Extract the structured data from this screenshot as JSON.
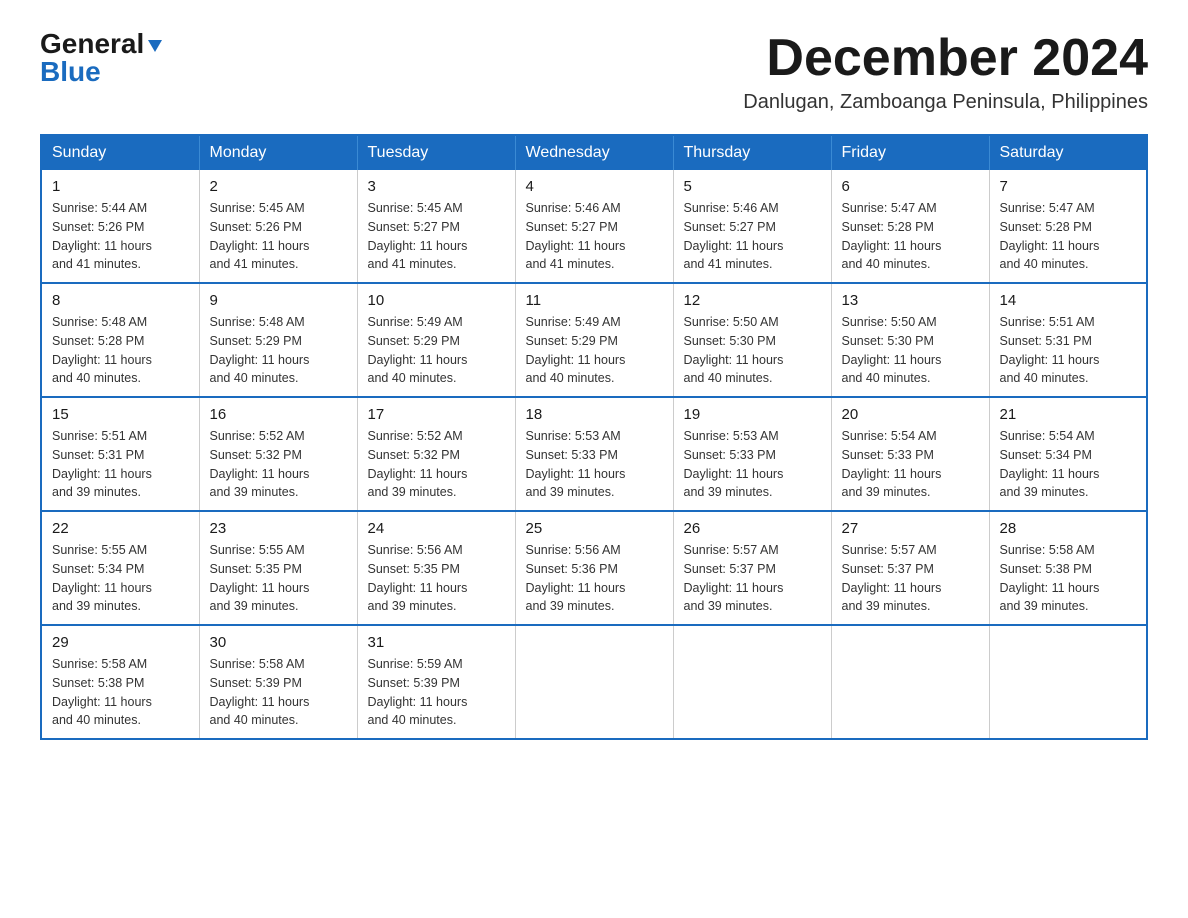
{
  "logo": {
    "general": "General",
    "blue": "Blue",
    "triangle": "▶"
  },
  "title": {
    "month_year": "December 2024",
    "location": "Danlugan, Zamboanga Peninsula, Philippines"
  },
  "header": {
    "days": [
      "Sunday",
      "Monday",
      "Tuesday",
      "Wednesday",
      "Thursday",
      "Friday",
      "Saturday"
    ]
  },
  "weeks": [
    [
      {
        "day": "1",
        "info": "Sunrise: 5:44 AM\nSunset: 5:26 PM\nDaylight: 11 hours\nand 41 minutes."
      },
      {
        "day": "2",
        "info": "Sunrise: 5:45 AM\nSunset: 5:26 PM\nDaylight: 11 hours\nand 41 minutes."
      },
      {
        "day": "3",
        "info": "Sunrise: 5:45 AM\nSunset: 5:27 PM\nDaylight: 11 hours\nand 41 minutes."
      },
      {
        "day": "4",
        "info": "Sunrise: 5:46 AM\nSunset: 5:27 PM\nDaylight: 11 hours\nand 41 minutes."
      },
      {
        "day": "5",
        "info": "Sunrise: 5:46 AM\nSunset: 5:27 PM\nDaylight: 11 hours\nand 41 minutes."
      },
      {
        "day": "6",
        "info": "Sunrise: 5:47 AM\nSunset: 5:28 PM\nDaylight: 11 hours\nand 40 minutes."
      },
      {
        "day": "7",
        "info": "Sunrise: 5:47 AM\nSunset: 5:28 PM\nDaylight: 11 hours\nand 40 minutes."
      }
    ],
    [
      {
        "day": "8",
        "info": "Sunrise: 5:48 AM\nSunset: 5:28 PM\nDaylight: 11 hours\nand 40 minutes."
      },
      {
        "day": "9",
        "info": "Sunrise: 5:48 AM\nSunset: 5:29 PM\nDaylight: 11 hours\nand 40 minutes."
      },
      {
        "day": "10",
        "info": "Sunrise: 5:49 AM\nSunset: 5:29 PM\nDaylight: 11 hours\nand 40 minutes."
      },
      {
        "day": "11",
        "info": "Sunrise: 5:49 AM\nSunset: 5:29 PM\nDaylight: 11 hours\nand 40 minutes."
      },
      {
        "day": "12",
        "info": "Sunrise: 5:50 AM\nSunset: 5:30 PM\nDaylight: 11 hours\nand 40 minutes."
      },
      {
        "day": "13",
        "info": "Sunrise: 5:50 AM\nSunset: 5:30 PM\nDaylight: 11 hours\nand 40 minutes."
      },
      {
        "day": "14",
        "info": "Sunrise: 5:51 AM\nSunset: 5:31 PM\nDaylight: 11 hours\nand 40 minutes."
      }
    ],
    [
      {
        "day": "15",
        "info": "Sunrise: 5:51 AM\nSunset: 5:31 PM\nDaylight: 11 hours\nand 39 minutes."
      },
      {
        "day": "16",
        "info": "Sunrise: 5:52 AM\nSunset: 5:32 PM\nDaylight: 11 hours\nand 39 minutes."
      },
      {
        "day": "17",
        "info": "Sunrise: 5:52 AM\nSunset: 5:32 PM\nDaylight: 11 hours\nand 39 minutes."
      },
      {
        "day": "18",
        "info": "Sunrise: 5:53 AM\nSunset: 5:33 PM\nDaylight: 11 hours\nand 39 minutes."
      },
      {
        "day": "19",
        "info": "Sunrise: 5:53 AM\nSunset: 5:33 PM\nDaylight: 11 hours\nand 39 minutes."
      },
      {
        "day": "20",
        "info": "Sunrise: 5:54 AM\nSunset: 5:33 PM\nDaylight: 11 hours\nand 39 minutes."
      },
      {
        "day": "21",
        "info": "Sunrise: 5:54 AM\nSunset: 5:34 PM\nDaylight: 11 hours\nand 39 minutes."
      }
    ],
    [
      {
        "day": "22",
        "info": "Sunrise: 5:55 AM\nSunset: 5:34 PM\nDaylight: 11 hours\nand 39 minutes."
      },
      {
        "day": "23",
        "info": "Sunrise: 5:55 AM\nSunset: 5:35 PM\nDaylight: 11 hours\nand 39 minutes."
      },
      {
        "day": "24",
        "info": "Sunrise: 5:56 AM\nSunset: 5:35 PM\nDaylight: 11 hours\nand 39 minutes."
      },
      {
        "day": "25",
        "info": "Sunrise: 5:56 AM\nSunset: 5:36 PM\nDaylight: 11 hours\nand 39 minutes."
      },
      {
        "day": "26",
        "info": "Sunrise: 5:57 AM\nSunset: 5:37 PM\nDaylight: 11 hours\nand 39 minutes."
      },
      {
        "day": "27",
        "info": "Sunrise: 5:57 AM\nSunset: 5:37 PM\nDaylight: 11 hours\nand 39 minutes."
      },
      {
        "day": "28",
        "info": "Sunrise: 5:58 AM\nSunset: 5:38 PM\nDaylight: 11 hours\nand 39 minutes."
      }
    ],
    [
      {
        "day": "29",
        "info": "Sunrise: 5:58 AM\nSunset: 5:38 PM\nDaylight: 11 hours\nand 40 minutes."
      },
      {
        "day": "30",
        "info": "Sunrise: 5:58 AM\nSunset: 5:39 PM\nDaylight: 11 hours\nand 40 minutes."
      },
      {
        "day": "31",
        "info": "Sunrise: 5:59 AM\nSunset: 5:39 PM\nDaylight: 11 hours\nand 40 minutes."
      },
      {
        "day": "",
        "info": ""
      },
      {
        "day": "",
        "info": ""
      },
      {
        "day": "",
        "info": ""
      },
      {
        "day": "",
        "info": ""
      }
    ]
  ]
}
